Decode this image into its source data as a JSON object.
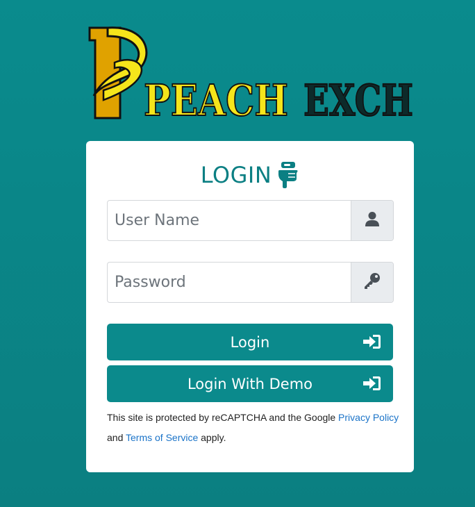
{
  "logo": {
    "letter": "P",
    "word1": "PEACH",
    "word2": "EXCH"
  },
  "form": {
    "title": "LOGIN",
    "username_placeholder": "User Name",
    "password_placeholder": "Password",
    "login_label": "Login",
    "demo_label": "Login With Demo"
  },
  "recaptcha": {
    "text_before": "This site is protected by reCAPTCHA and the Google ",
    "privacy_link": "Privacy Policy",
    "text_middle": " and ",
    "terms_link": "Terms of Service",
    "text_after": " apply."
  },
  "icons": {
    "title": "hand-pointing-down-icon",
    "username": "user-icon",
    "password": "key-icon",
    "login": "sign-in-icon"
  },
  "colors": {
    "background": "#0a8b8d",
    "accent": "#0b8a8c",
    "logo_yellow": "#f5e51b",
    "logo_gold": "#e0a200",
    "link": "#1a73c8"
  }
}
